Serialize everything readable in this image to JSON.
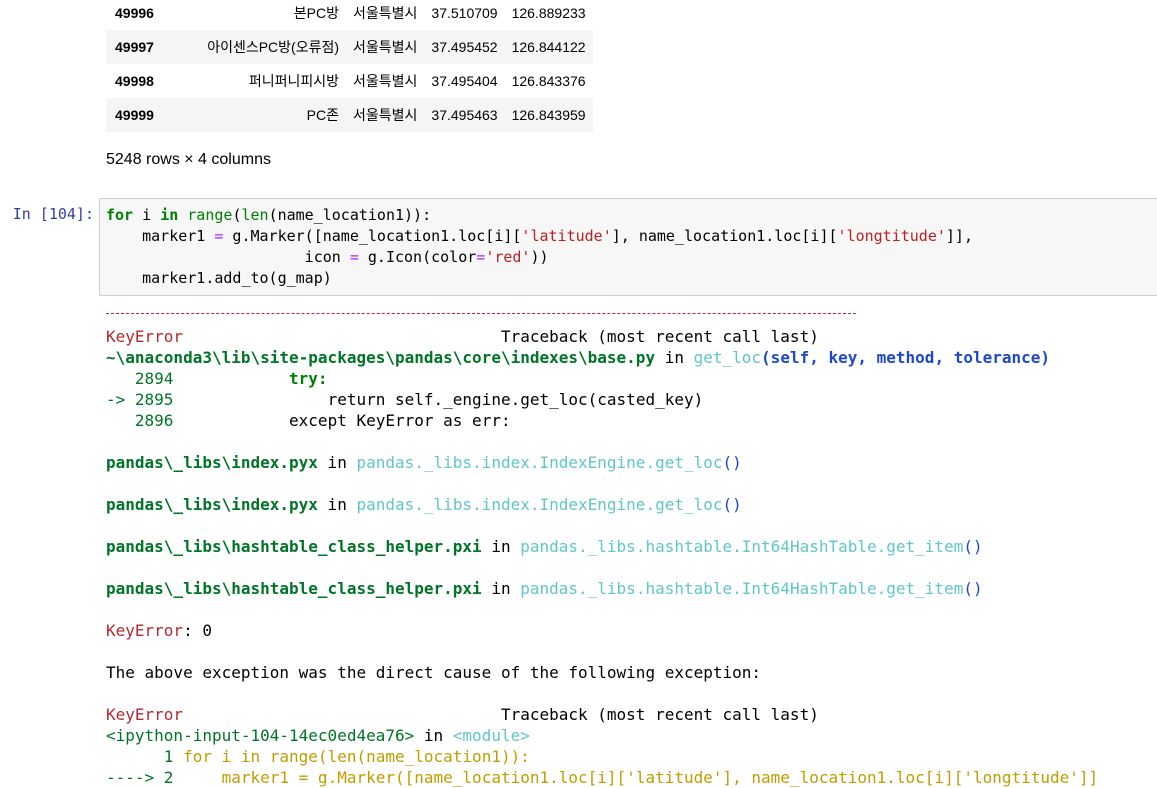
{
  "dataframe": {
    "rows": [
      {
        "idx": "49996",
        "name": "본PC방",
        "city": "서울특별시",
        "lat": "37.510709",
        "lon": "126.889233"
      },
      {
        "idx": "49997",
        "name": "아이센스PC방(오류점)",
        "city": "서울특별시",
        "lat": "37.495452",
        "lon": "126.844122"
      },
      {
        "idx": "49998",
        "name": "퍼니퍼니피시방",
        "city": "서울특별시",
        "lat": "37.495404",
        "lon": "126.843376"
      },
      {
        "idx": "49999",
        "name": "PC존",
        "city": "서울특별시",
        "lat": "37.495463",
        "lon": "126.843959"
      }
    ],
    "shape": "5248 rows × 4 columns"
  },
  "cell": {
    "prompt": "In [104]:",
    "code": {
      "l1_for": "for",
      "l1_var": " i ",
      "l1_in": "in",
      "l1_sp": " ",
      "l1_range": "range",
      "l1_p1": "(",
      "l1_len": "len",
      "l1_rest": "(name_location1)):",
      "l2_a": "    marker1 ",
      "l2_eq": "=",
      "l2_b": " g.Marker([name_location1.loc[i][",
      "l2_s1": "'latitude'",
      "l2_c": "], name_location1.loc[i][",
      "l2_s2": "'longtitude'",
      "l2_d": "]],",
      "l3_a": "                      icon ",
      "l3_eq": "=",
      "l3_b": " g.Icon(color",
      "l3_eq2": "=",
      "l3_s": "'red'",
      "l3_c": "))",
      "l4": "    marker1.add_to(g_map)"
    }
  },
  "traceback": {
    "err1": "KeyError",
    "hdr1": "                                 Traceback (most recent call last)",
    "path1": "~\\anaconda3\\lib\\site-packages\\pandas\\core\\indexes\\base.py",
    "in1": " in ",
    "fn1": "get_loc",
    "args1": "(self, key, method, tolerance)",
    "l2894_no": "   2894",
    "l2894_code": "            try:",
    "l2895_no": "-> 2895",
    "l2895_code": "                return self._engine.get_loc(casted_key)",
    "l2896_no": "   2896",
    "l2896_code": "            except KeyError as err:",
    "f1_path": "pandas\\_libs\\index.pyx",
    "f1_in": " in ",
    "f1_fn": "pandas._libs.index.IndexEngine.get_loc",
    "f1_p": "()",
    "f2_path": "pandas\\_libs\\index.pyx",
    "f2_in": " in ",
    "f2_fn": "pandas._libs.index.IndexEngine.get_loc",
    "f2_p": "()",
    "f3_path": "pandas\\_libs\\hashtable_class_helper.pxi",
    "f3_in": " in ",
    "f3_fn": "pandas._libs.hashtable.Int64HashTable.get_item",
    "f3_p": "()",
    "f4_path": "pandas\\_libs\\hashtable_class_helper.pxi",
    "f4_in": " in ",
    "f4_fn": "pandas._libs.hashtable.Int64HashTable.get_item",
    "f4_p": "()",
    "keyerr_label": "KeyError",
    "keyerr_val": ": 0",
    "cause": "The above exception was the direct cause of the following exception:",
    "err2": "KeyError",
    "hdr2": "                                 Traceback (most recent call last)",
    "ipy_path": "<ipython-input-104-14ec0ed4ea76>",
    "ipy_in": " in ",
    "ipy_mod": "<module>",
    "m1_no": "      1",
    "m1_code": " for i in range(len(name_location1)):",
    "m2_no": "----> 2",
    "m2_code": "     marker1 = g.Marker([name_location1.loc[i]['latitude'], name_location1.loc[i]['longtitude']]"
  }
}
